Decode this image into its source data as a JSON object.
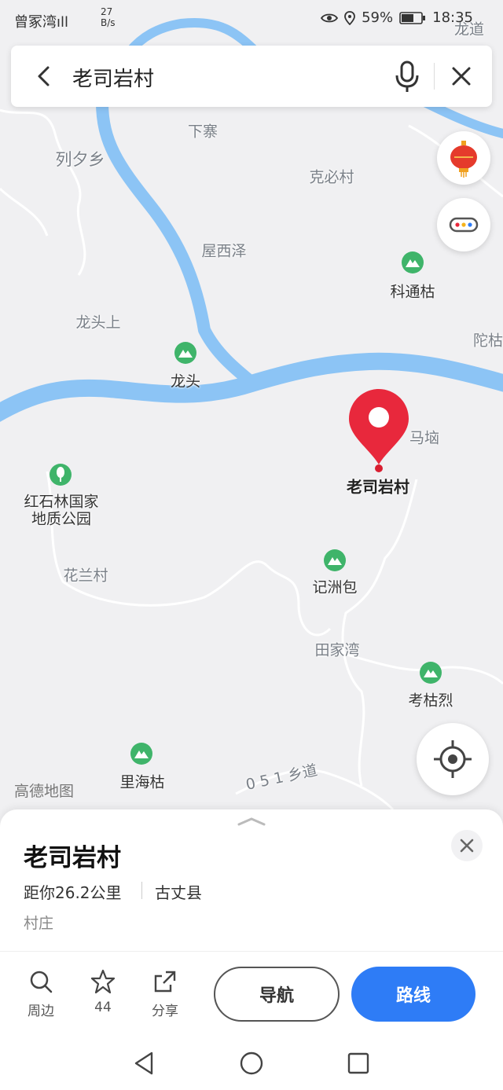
{
  "status_bar": {
    "carrier": "曾冢湾ıll",
    "speed_value": "27",
    "speed_unit": "B/s",
    "battery": "59%",
    "time": "18:35"
  },
  "search": {
    "query": "老司岩村"
  },
  "map": {
    "river_color": "#8cc4f5",
    "labels": {
      "longdao": "龙道",
      "xiazhai": "下寨",
      "liexixiang": "列夕乡",
      "kebicun": "克必村",
      "wuxize": "屋西泽",
      "ketonggu": "科通枯",
      "longtoushang": "龙头上",
      "tuogu": "陀枯",
      "longtou": "龙头",
      "mawo": "马垴",
      "laosiyancun": "老司岩村",
      "hongshilin_1": "红石林国家",
      "hongshilin_2": "地质公园",
      "hualancun": "花兰村",
      "jizhoubao": "记洲包",
      "tianjiawan": "田家湾",
      "kaoguli": "考枯烈",
      "lihaigu": "里海枯",
      "road": "0 5 1 乡道"
    },
    "watermark": "高德地图"
  },
  "detail": {
    "title": "老司岩村",
    "distance": "距你26.2公里",
    "county": "古丈县",
    "category": "村庄",
    "actions": {
      "nearby": "周边",
      "favorites": "44",
      "share": "分享"
    },
    "navigate_label": "导航",
    "route_label": "路线",
    "accent_color": "#2e7cf6",
    "pin_color": "#e8283c"
  }
}
